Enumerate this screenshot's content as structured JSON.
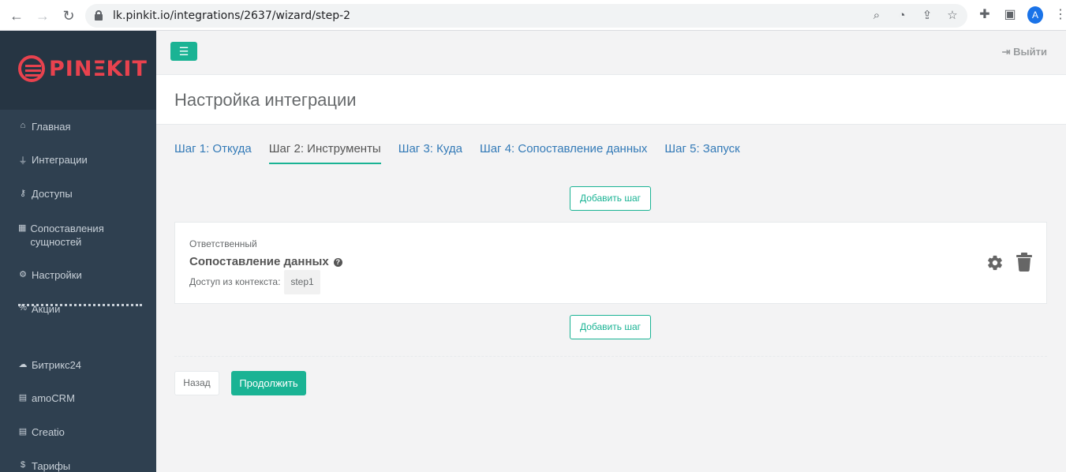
{
  "browser": {
    "url": "lk.pinkit.io/integrations/2637/wizard/step-2",
    "avatar_letter": "A"
  },
  "sidebar": {
    "logo_text": "PINEKIT",
    "items": [
      {
        "label": "Главная",
        "icon": "home-icon"
      },
      {
        "label": "Интеграции",
        "icon": "plug-icon"
      },
      {
        "label": "Доступы",
        "icon": "key-icon"
      },
      {
        "label": "Сопоставления сущностей",
        "icon": "table-icon"
      },
      {
        "label": "Настройки",
        "icon": "gears-icon"
      },
      {
        "label": "Акции",
        "icon": "percent-icon"
      }
    ],
    "crm_items": [
      {
        "label": "Битрикс24",
        "icon": "cloud-icon"
      },
      {
        "label": "amoCRM",
        "icon": "server-icon"
      },
      {
        "label": "Creatio",
        "icon": "server-icon"
      },
      {
        "label": "Тарифы",
        "icon": "dollar-icon"
      }
    ]
  },
  "topbar": {
    "logout_label": "Выйти"
  },
  "page": {
    "title": "Настройка интеграции"
  },
  "tabs": [
    {
      "label": "Шаг 1: Откуда",
      "active": false
    },
    {
      "label": "Шаг 2: Инструменты",
      "active": true
    },
    {
      "label": "Шаг 3: Куда",
      "active": false
    },
    {
      "label": "Шаг 4: Сопоставление данных",
      "active": false
    },
    {
      "label": "Шаг 5: Запуск",
      "active": false
    }
  ],
  "steps": {
    "add_step_label": "Добавить шаг",
    "card": {
      "label": "Ответственный",
      "title": "Сопоставление данных",
      "context_label": "Доступ из контекста:",
      "context_value": "step1"
    }
  },
  "footer": {
    "back_label": "Назад",
    "next_label": "Продолжить"
  },
  "colors": {
    "accent": "#1ab394",
    "sidebar_bg": "#2f4050",
    "link": "#337ab7",
    "logo": "#e8424e"
  }
}
